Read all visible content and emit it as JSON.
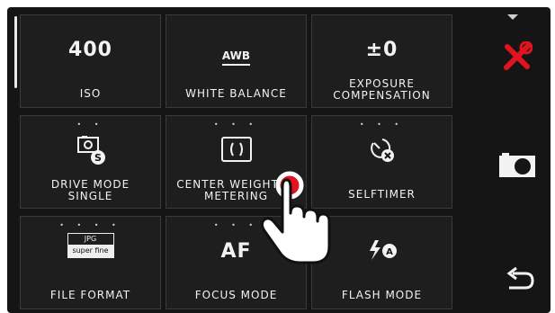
{
  "tiles": [
    {
      "value": "400",
      "label": "ISO"
    },
    {
      "value": "AWB",
      "label": "WHITE BALANCE"
    },
    {
      "value": "±0",
      "label": "EXPOSURE",
      "label2": "COMPENSATION"
    },
    {
      "label": "DRIVE MODE",
      "label2": "SINGLE",
      "dots": "• •"
    },
    {
      "label": "CENTER WEIGHTED",
      "label2": "METERING",
      "dots": "• • •"
    },
    {
      "label": "SELFTIMER",
      "dots": "• • •"
    },
    {
      "label": "FILE FORMAT",
      "dots": "• • • •",
      "format_top": "JPG",
      "format_bottom": "super fine"
    },
    {
      "value": "AF",
      "label": "FOCUS MODE",
      "dots": "• • •"
    },
    {
      "value": "⚡",
      "label": "FLASH MODE"
    }
  ],
  "colors": {
    "accent": "#e0141e",
    "screen": "#151515",
    "tile": "#1e1e1e"
  },
  "icons": {
    "settings": "tools-icon",
    "camera": "camera-icon",
    "back": "back-arrow-icon",
    "touch": "hand-tap-icon"
  }
}
